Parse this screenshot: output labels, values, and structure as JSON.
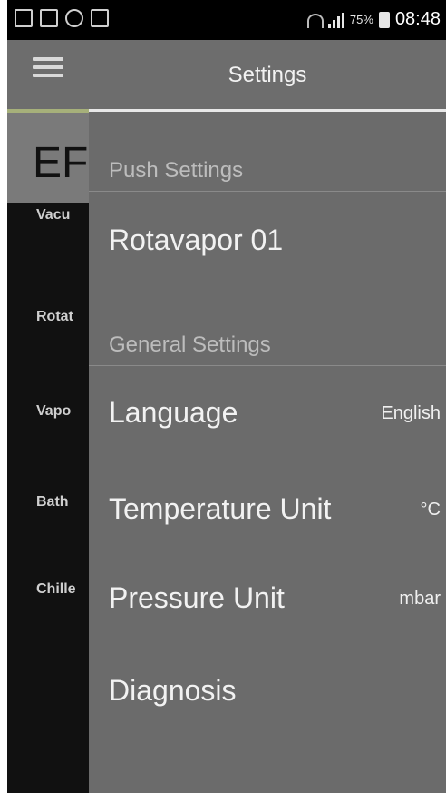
{
  "statusbar": {
    "battery_percent": "75%",
    "time": "08:48"
  },
  "background_app": {
    "title_fragment": "EF",
    "labels": [
      "Vacu",
      "Rotat",
      "Vapo",
      "Bath",
      "Chille"
    ]
  },
  "drawer": {
    "title": "Settings",
    "push_section": {
      "title": "Push Settings",
      "items": [
        {
          "label": "Rotavapor 01"
        }
      ]
    },
    "general_section": {
      "title": "General Settings",
      "items": [
        {
          "label": "Language",
          "value": "English"
        },
        {
          "label": "Temperature Unit",
          "value": "°C"
        },
        {
          "label": "Pressure Unit",
          "value": "mbar"
        },
        {
          "label": "Diagnosis"
        }
      ]
    }
  }
}
